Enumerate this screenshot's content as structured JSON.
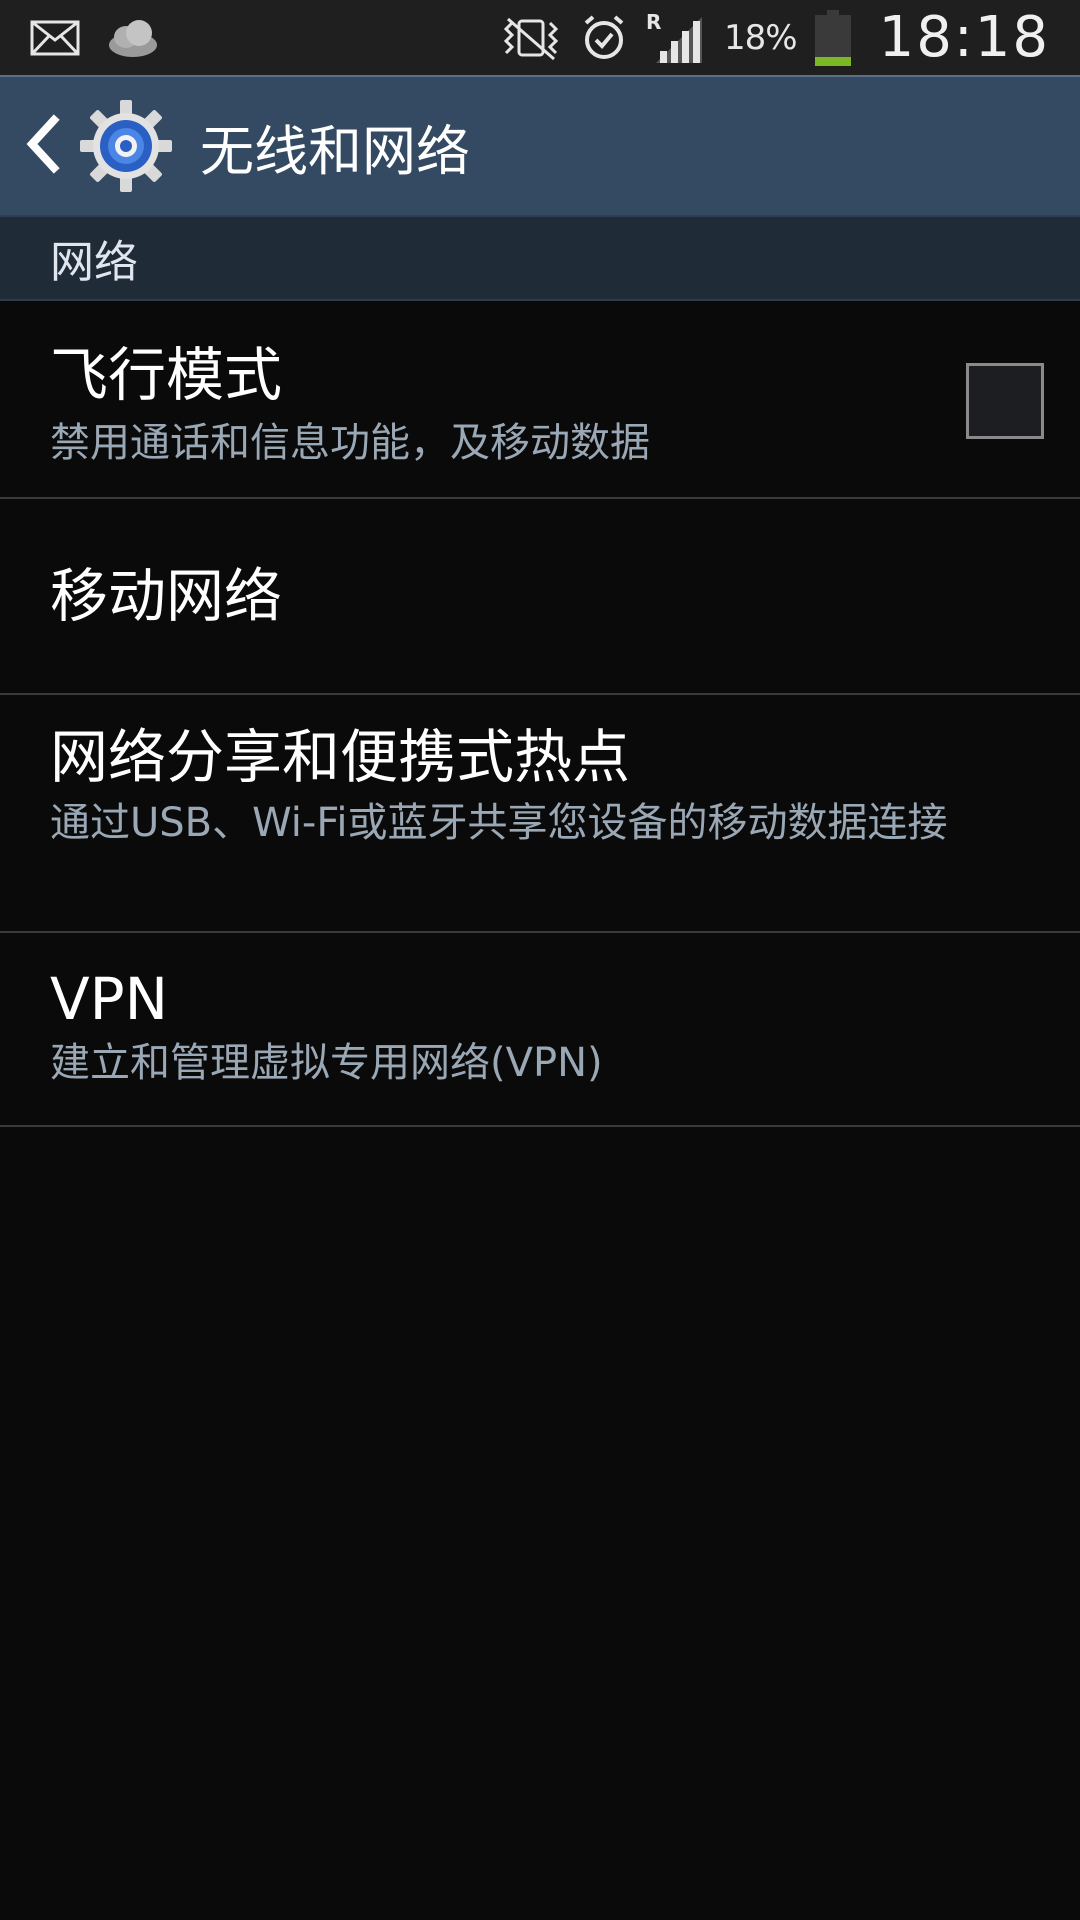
{
  "status_bar": {
    "icons": [
      "mail-icon",
      "weather-cloud-icon",
      "vibrate-off-icon",
      "alarm-icon",
      "roaming-signal-icon",
      "battery-icon"
    ],
    "roaming_label": "R",
    "battery_percent": "18%",
    "battery_level": 0.18,
    "battery_color": "#7ab824",
    "time": "18:18"
  },
  "action_bar": {
    "title": "无线和网络",
    "background": "#344a62"
  },
  "section": {
    "title": "网络"
  },
  "items": [
    {
      "title": "飞行模式",
      "summary": "禁用通话和信息功能，及移动数据",
      "checked": false
    },
    {
      "title": "移动网络"
    },
    {
      "title": "网络分享和便携式热点",
      "summary": "通过USB、Wi-Fi或蓝牙共享您设备的移动数据连接"
    },
    {
      "title": "VPN",
      "summary": "建立和管理虚拟专用网络(VPN)"
    }
  ]
}
